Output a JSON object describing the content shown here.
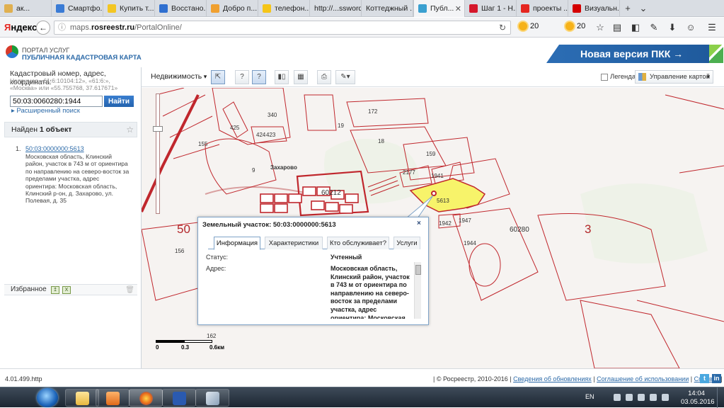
{
  "browser": {
    "tabs": [
      {
        "label": "ак...",
        "color": "#e0b050"
      },
      {
        "label": "Смартфо...",
        "color": "#3a7bd5"
      },
      {
        "label": "Купить т...",
        "color": "#f3c623"
      },
      {
        "label": "Восстано...",
        "color": "#2f6fd0"
      },
      {
        "label": "Добро п...",
        "color": "#f0a030"
      },
      {
        "label": "телефон...",
        "color": "#f5c518"
      },
      {
        "label": "http://...ssword",
        "color": ""
      },
      {
        "label": "Коттеджный ...",
        "color": ""
      },
      {
        "label": "Публ...",
        "color": "#3aa0d0"
      },
      {
        "label": "Шаг 1 - Н...",
        "color": "#d5172b"
      },
      {
        "label": "проекты ...",
        "color": "#e52620"
      },
      {
        "label": "Визуальн...",
        "color": "#d40000"
      }
    ],
    "new_tab": "+",
    "tabs_menu": "⌄",
    "brand": {
      "first": "Я",
      "rest": "ндекс"
    },
    "back": "←",
    "url": {
      "host_prefix": "maps.",
      "host": "rosreestr.ru",
      "path": "/PortalOnline/"
    },
    "weather1": "20",
    "weather2": "20"
  },
  "site": {
    "portal_line1": "ПОРТАЛ УСЛУГ",
    "portal_line2": "ПУБЛИЧНАЯ КАДАСТРОВАЯ КАРТА",
    "new_version": "Новая версия ПКК →"
  },
  "sidebar": {
    "search_label": "Кадастровый номер, адрес, координата:",
    "search_hint": "Например «61:6:10104:12», «61:6:», «Москва» или «55.755768, 37.617671»",
    "search_value": "50:03:0060280:1944",
    "search_button": "Найти",
    "advanced": "Расширенный поиск",
    "found_prefix": "Найден ",
    "found_count": "1 объект",
    "result": {
      "num": "1.",
      "link": "50:03:0000000:5613",
      "desc": "Московская область, Клинский район, участок в 743 м от ориентира по направлению на северо-восток за пределами участка, адрес ориентира: Московская область, Клинский р-он, д. Захарово, ул. Полевая, д. 35"
    },
    "favorites": "Избранное"
  },
  "toolbar": {
    "layer": "Недвижимость",
    "legend": "Легенда",
    "map_control": "Управление картой"
  },
  "map": {
    "labels": {
      "l340": "340",
      "l425": "425",
      "l424": "424",
      "l423": "423",
      "l172": "172",
      "l19": "19",
      "l18": "18",
      "l9": "9",
      "l159": "159",
      "l2177": "2177",
      "l1941": "1941",
      "lzakharovo": "Захарово",
      "l60212": "60212",
      "l5613": "5613",
      "l1942": "1942",
      "l1947": "1947",
      "l60280": "60280",
      "l1944": "1944",
      "l3": "3",
      "l50": "50",
      "l156": "156",
      "l162": "162",
      "l155": "155"
    },
    "scale": {
      "s0": "0",
      "s1": "0.3",
      "s2": "0.6км"
    },
    "highlight_color": "#f7f36a",
    "boundary_color": "#c0272d"
  },
  "popup": {
    "title": "Земельный участок: 50:03:0000000:5613",
    "close": "×",
    "tabs": [
      "Информация",
      "Характеристики",
      "Кто обслуживает?",
      "Услуги"
    ],
    "status_label": "Статус:",
    "status_value": "Учтенный",
    "address_label": "Адрес:",
    "address_value": "Московская область, Клинский район, участок в 743 м от ориентира по направлению на северо-восток за пределами участка, адрес ориентира: Московская область,"
  },
  "footer": {
    "version": "4.01.499.http",
    "copyright": "| © Росреестр, 2010-2016 |",
    "link_updates": "Сведения об обновлениях",
    "link_terms": "Соглашение об использовании",
    "link_help": "Справка"
  },
  "taskbar": {
    "lang": "EN",
    "time": "14:04",
    "date": "03.05.2016"
  }
}
